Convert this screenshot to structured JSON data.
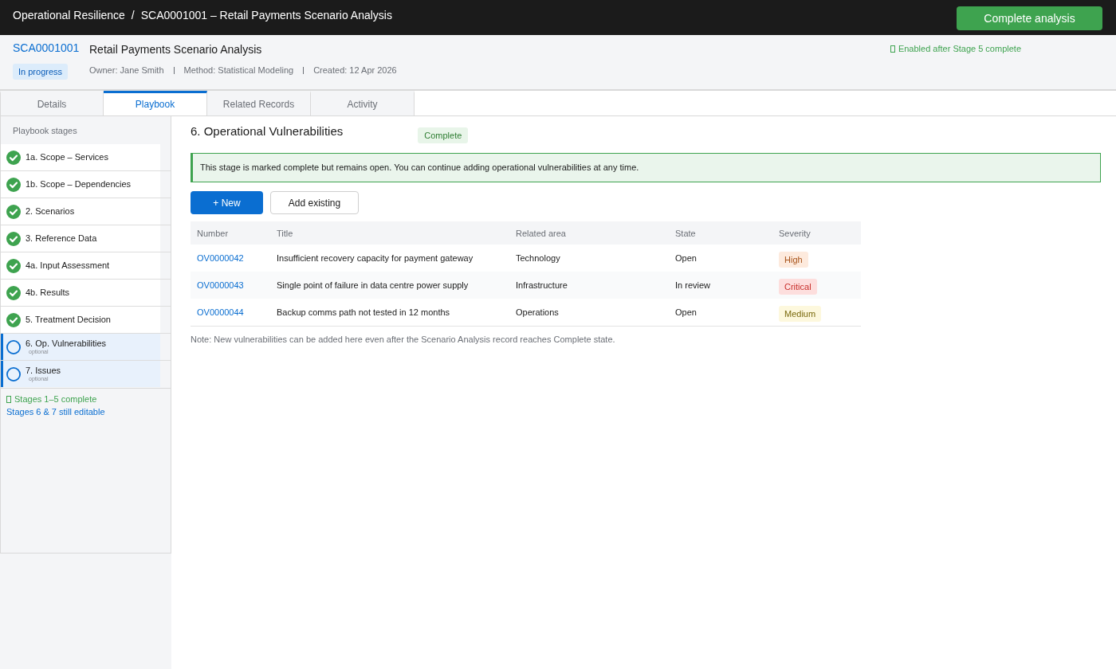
{
  "topbar": {
    "breadcrumb": [
      "Operational Resilience",
      "SCA0001001 – Retail Payments Scenario Analysis"
    ],
    "separator": "/",
    "action": "Complete analysis"
  },
  "record": {
    "number": "SCA0001001",
    "title": "Retail Payments Scenario Analysis",
    "status": "In progress",
    "meta": [
      "Owner: Jane Smith",
      "Method: Statistical Modeling",
      "Created: 12 Apr 2026"
    ],
    "hint": "Enabled after Stage 5 complete"
  },
  "tabs": [
    {
      "label": "Details",
      "selected": false
    },
    {
      "label": "Playbook",
      "selected": true
    },
    {
      "label": "Related Records",
      "selected": false
    },
    {
      "label": "Activity",
      "selected": false
    }
  ],
  "sidebar": {
    "title": "Playbook stages",
    "stages": [
      {
        "label": "1a. Scope – Services",
        "complete": true,
        "editable": false
      },
      {
        "label": "1b. Scope – Dependencies",
        "complete": true,
        "editable": false
      },
      {
        "label": "2. Scenarios",
        "complete": true,
        "editable": false
      },
      {
        "label": "3. Reference Data",
        "complete": true,
        "editable": false
      },
      {
        "label": "4a. Input Assessment",
        "complete": true,
        "editable": false
      },
      {
        "label": "4b. Results",
        "complete": true,
        "editable": false
      },
      {
        "label": "5. Treatment Decision",
        "complete": true,
        "editable": false
      },
      {
        "label": "6. Op. Vulnerabilities",
        "note": "optional",
        "complete": false,
        "editable": true
      },
      {
        "label": "7. Issues",
        "note": "optional",
        "complete": false,
        "editable": true
      }
    ],
    "summary": [
      {
        "kind": "complete",
        "text": "Stages 1–5 complete"
      },
      {
        "kind": "editable",
        "text": "Stages 6 & 7 still editable"
      }
    ]
  },
  "main": {
    "heading": "6. Operational Vulnerabilities",
    "status": "Complete",
    "notice": "This stage is marked complete but remains open. You can continue adding operational vulnerabilities at any time.",
    "buttons": [
      {
        "label": "+ New",
        "kind": "primary"
      },
      {
        "label": "Add existing",
        "kind": "secondary"
      }
    ],
    "table": {
      "columns": [
        "Number",
        "Title",
        "Related area",
        "State",
        "Severity"
      ],
      "rows": [
        {
          "number": "OV0000042",
          "title": "Insufficient recovery capacity for payment gateway",
          "area": "Technology",
          "state": "Open",
          "severity": {
            "label": "High",
            "color": "#a8531a"
          }
        },
        {
          "number": "OV0000043",
          "title": "Single point of failure in data centre power supply",
          "area": "Infrastructure",
          "state": "In review",
          "severity": {
            "label": "Critical",
            "color": "#c8302c"
          }
        },
        {
          "number": "OV0000044",
          "title": "Backup comms path not tested in 12 months",
          "area": "Operations",
          "state": "Open",
          "severity": {
            "label": "Medium",
            "color": "#7a6a0e"
          }
        }
      ]
    },
    "note": "Note: New vulnerabilities can be added here even after the Scenario Analysis record reaches Complete state."
  }
}
